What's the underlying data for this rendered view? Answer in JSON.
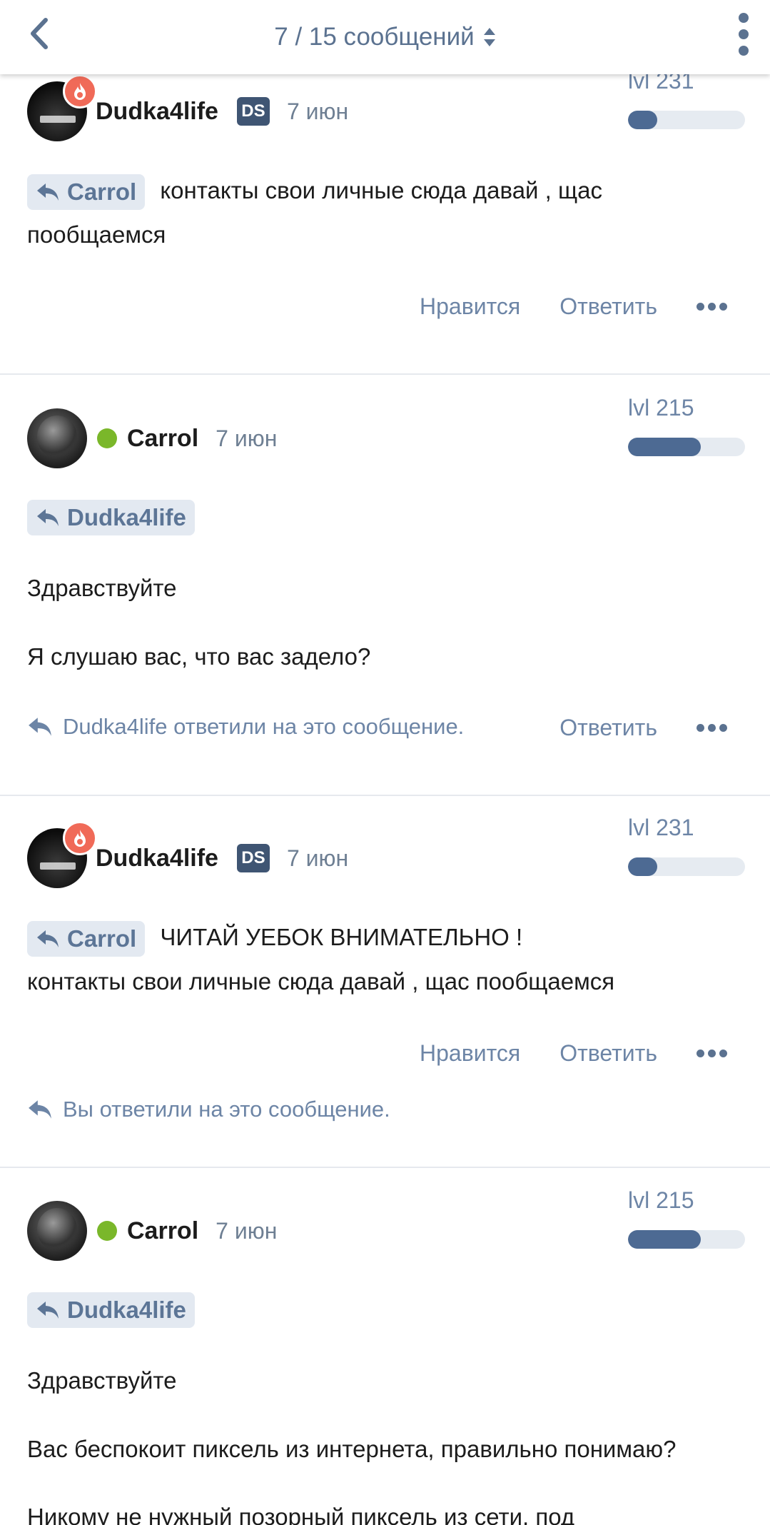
{
  "header": {
    "title": "7 / 15 сообщений"
  },
  "posts": [
    {
      "author": "Dudka4life",
      "badge": "DS",
      "date": "7 июн",
      "level": "lvl 231",
      "level_progress": 0.25,
      "reply_to": "Carrol",
      "text_lines": [
        "контакты свои личные сюда давай , щас",
        "пообщаемся"
      ],
      "actions": {
        "like": "Нравится",
        "reply": "Ответить"
      }
    },
    {
      "author": "Carrol",
      "date": "7 июн",
      "level": "lvl 215",
      "level_progress": 0.62,
      "reply_to": "Dudka4life",
      "paragraphs": [
        "Здравствуйте",
        "Я слушаю вас, что вас задело?"
      ],
      "reply_note": "Dudka4life ответили на это сообщение.",
      "actions": {
        "reply": "Ответить"
      }
    },
    {
      "author": "Dudka4life",
      "badge": "DS",
      "date": "7 июн",
      "level": "lvl 231",
      "level_progress": 0.25,
      "reply_to": "Carrol",
      "text_lines": [
        "ЧИТАЙ УЕБОК ВНИМАТЕЛЬНО !",
        "контакты свои личные сюда давай , щас пообщаемся"
      ],
      "actions": {
        "like": "Нравится",
        "reply": "Ответить"
      },
      "reply_note": "Вы ответили на это сообщение."
    },
    {
      "author": "Carrol",
      "date": "7 июн",
      "level": "lvl 215",
      "level_progress": 0.62,
      "reply_to": "Dudka4life",
      "paragraphs": [
        "Здравствуйте",
        "Вас беспокоит пиксель из интернета, правильно понимаю?",
        "Никому не нужный позорный пиксель из сети, под"
      ]
    }
  ],
  "icons": {
    "back": "chevron-left-icon",
    "sort": "sort-updown-icon",
    "menu": "more-vertical-icon",
    "reply": "reply-arrow-icon",
    "more": "more-horizontal-icon",
    "fire": "fire-icon"
  },
  "colors": {
    "accent": "#5b7290",
    "link": "#6d85a6",
    "level_fill": "#4d6a93",
    "online": "#7ab72a",
    "fire": "#f06a58",
    "badge": "#3f5573"
  }
}
